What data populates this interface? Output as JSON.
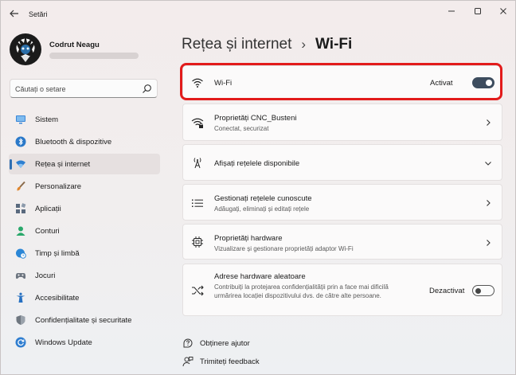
{
  "window": {
    "title": "Setări"
  },
  "profile": {
    "name": "Codrut Neagu"
  },
  "search": {
    "placeholder": "Căutați o setare"
  },
  "nav": {
    "items": [
      {
        "label": "Sistem",
        "icon": "monitor-icon",
        "color": "#3a86d6"
      },
      {
        "label": "Bluetooth & dispozitive",
        "icon": "bluetooth-icon",
        "color": "#2b79c9"
      },
      {
        "label": "Rețea și internet",
        "icon": "wifi-diamond-icon",
        "color": "#2e7fd0",
        "active": true
      },
      {
        "label": "Personalizare",
        "icon": "brush-icon",
        "color": "#e0872f"
      },
      {
        "label": "Aplicații",
        "icon": "apps-icon",
        "color": "#5a6a7e"
      },
      {
        "label": "Conturi",
        "icon": "person-icon",
        "color": "#2aa86b"
      },
      {
        "label": "Timp și limbă",
        "icon": "globe-clock-icon",
        "color": "#2b86d6"
      },
      {
        "label": "Jocuri",
        "icon": "gamepad-icon",
        "color": "#6d7580"
      },
      {
        "label": "Accesibilitate",
        "icon": "accessibility-icon",
        "color": "#2670c2"
      },
      {
        "label": "Confidențialitate și securitate",
        "icon": "shield-icon",
        "color": "#6f7780"
      },
      {
        "label": "Windows Update",
        "icon": "update-icon",
        "color": "#2f7ed0"
      }
    ]
  },
  "main": {
    "breadcrumb_parent": "Rețea și internet",
    "breadcrumb_sep": "›",
    "breadcrumb_current": "Wi-Fi",
    "wifi": {
      "title": "Wi-Fi",
      "state": "Activat",
      "on": true
    },
    "properties": {
      "title": "Proprietăți CNC_Busteni",
      "subtitle": "Conectat, securizat"
    },
    "available": {
      "title": "Afișați rețelele disponibile"
    },
    "known": {
      "title": "Gestionați rețelele cunoscute",
      "subtitle": "Adăugați, eliminați și editați rețele"
    },
    "hardware": {
      "title": "Proprietăți hardware",
      "subtitle": "Vizualizare și gestionare proprietăți adaptor Wi-Fi"
    },
    "random": {
      "title": "Adrese hardware aleatoare",
      "description": "Contribuiți la protejarea confidențialității prin a face mai dificilă urmărirea locației dispozitivului dvs. de către alte persoane.",
      "state": "Dezactivat",
      "on": false
    }
  },
  "footer": {
    "help": "Obținere ajutor",
    "feedback": "Trimiteți feedback"
  },
  "colors": {
    "accent": "#2f6fb3",
    "highlight": "#e21b1b",
    "toggle_on": "#3d4c5e"
  }
}
